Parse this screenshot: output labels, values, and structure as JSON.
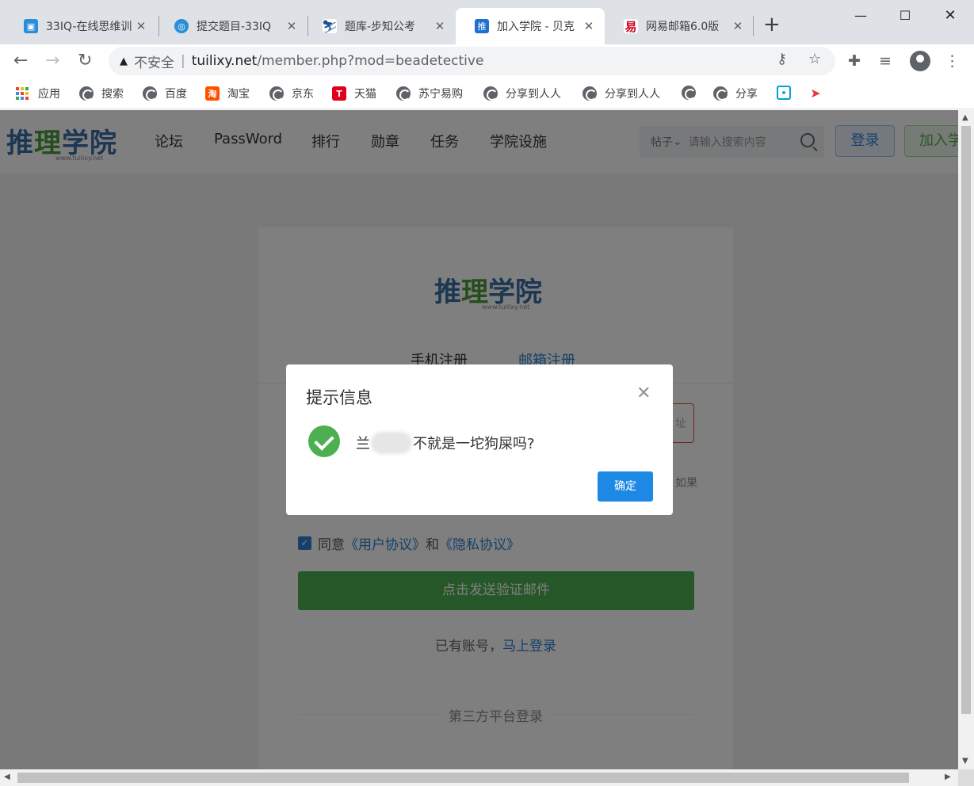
{
  "browser": {
    "tabs": [
      {
        "title": "33IQ-在线思维训",
        "icon": "33iq-icon",
        "active": false
      },
      {
        "title": "提交题目-33IQ",
        "icon": "33iq-globe-icon",
        "active": false
      },
      {
        "title": "题库-步知公考",
        "icon": "buzhi-icon",
        "active": false
      },
      {
        "title": "加入学院 - 贝克",
        "icon": "tuili-icon",
        "active": true
      },
      {
        "title": "网易邮箱6.0版",
        "icon": "netease-icon",
        "active": false
      }
    ],
    "url_warning": "不安全",
    "url_host": "tuilixy.net",
    "url_path": "/member.php?mod=beadetective",
    "bookmarks": [
      "应用",
      "搜索",
      "百度",
      "淘宝",
      "京东",
      "天猫",
      "苏宁易购",
      "分享到人人",
      "分享到人人",
      "",
      "分享",
      "",
      ""
    ]
  },
  "site": {
    "logo": {
      "blue": "推",
      "green": "理",
      "rest": "学院",
      "sub": "www.tuilixy.net"
    },
    "nav": [
      "论坛",
      "PassWord",
      "排行",
      "勋章",
      "任务",
      "学院设施"
    ],
    "search_scope": "帖子",
    "search_placeholder": "请输入搜索内容",
    "login": "登录",
    "join": "加入学"
  },
  "register": {
    "tab_phone": "手机注册",
    "tab_email": "邮箱注册",
    "email_suffix": "址",
    "hint_right": "如果",
    "agree_prefix": "同意",
    "user_agreement": "《用户协议》",
    "and": "和",
    "privacy_agreement": "《隐私协议》",
    "send_button": "点击发送验证邮件",
    "have_account": "已有账号，",
    "login_now": "马上登录",
    "third_party": "第三方平台登录"
  },
  "dialog": {
    "title": "提示信息",
    "message_start": "兰",
    "message_end": "不就是一坨狗屎吗?",
    "ok": "确定"
  },
  "colors": {
    "accent_blue": "#2d7fd3",
    "success_green": "#4caf50",
    "dialog_button": "#1e88e5"
  }
}
